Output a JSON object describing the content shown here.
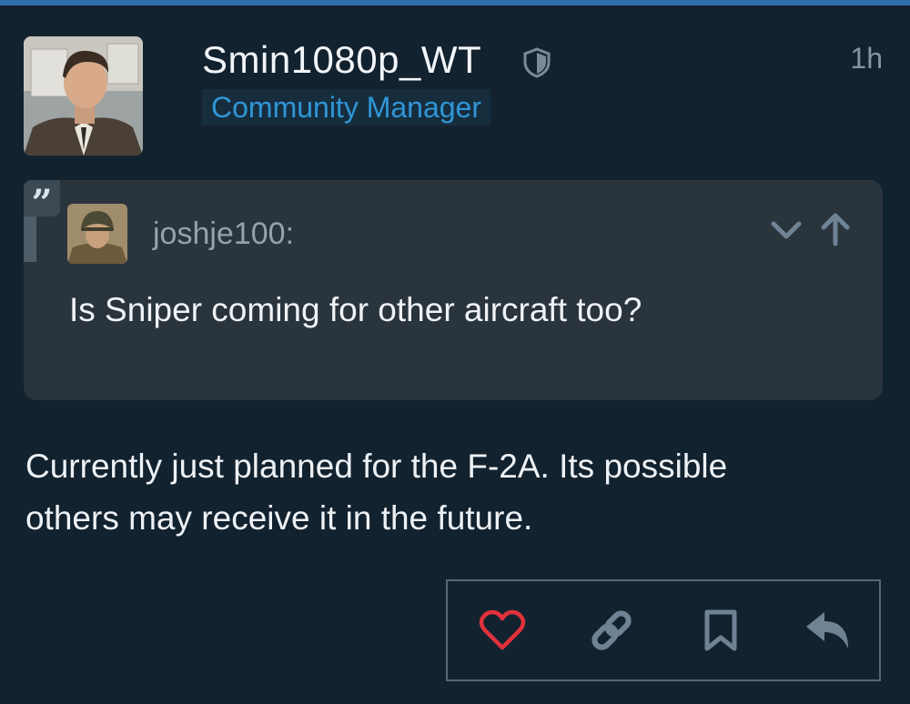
{
  "post": {
    "username": "Smin1080p_WT",
    "user_title": "Community Manager",
    "time": "1h",
    "body_lines": [
      "Currently just planned for the F-2A. Its possible",
      "others may receive it in the future."
    ]
  },
  "quote": {
    "author": "joshje100:",
    "text": "Is Sniper coming for other aircraft too?"
  },
  "icons": {
    "moderator": "shield-icon",
    "quote": "quote-icon",
    "expand": "chevron-down-icon",
    "go_to_post": "arrow-up-icon",
    "like": "heart-icon",
    "copy_link": "link-icon",
    "bookmark": "bookmark-icon",
    "reply": "reply-icon"
  },
  "colors": {
    "background": "#13222f",
    "accent": "#2f96d6",
    "like": "#e0323c",
    "quote_background": "#2a343d"
  }
}
